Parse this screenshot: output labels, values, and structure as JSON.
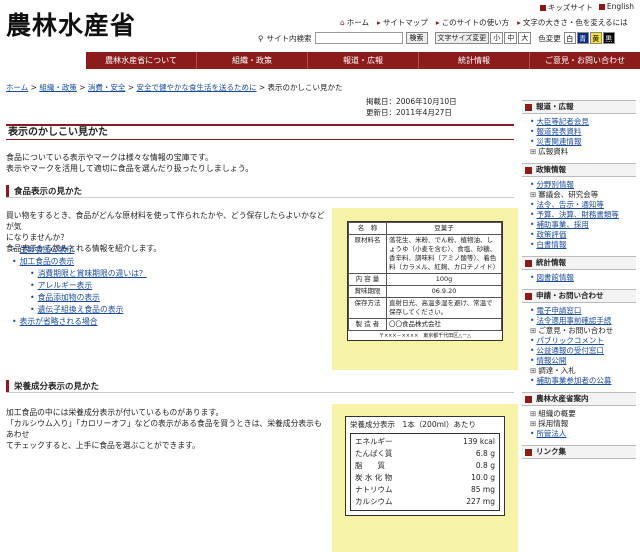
{
  "header": {
    "logo": "農林水産省",
    "util": [
      "キッズサイト",
      "English"
    ],
    "nav": [
      "ホーム",
      "サイトマップ",
      "このサイトの使い方",
      "文字の大きさ・色を変えるには"
    ],
    "search_label": "サイト内検索",
    "search_value": "",
    "search_button": "検索",
    "font_label": "文字サイズ変更",
    "font_sizes": [
      "小",
      "中",
      "大"
    ],
    "color_label": "色変更",
    "colors": [
      "白",
      "青",
      "黄",
      "黒"
    ]
  },
  "main_nav": [
    "農林水産省について",
    "組織・政策",
    "報道・広報",
    "統計情報",
    "ご意見・お問い合わせ"
  ],
  "breadcrumb": [
    "ホーム",
    "組織・政策",
    "消費・安全",
    "安全で健やかな食生活を送るために",
    "表示のかしこい見かた"
  ],
  "dates": {
    "published": "掲載日：2006年10月10日",
    "updated": "更新日：2011年4月27日"
  },
  "page_title": "表示のかしこい見かた",
  "intro": [
    "食品についている表示やマークは様々な情報の宝庫です。",
    "表示やマークを活用して適切に食品を選んだり扱ったりしましょう。"
  ],
  "section1": {
    "title": "食品表示の見かた",
    "text": [
      "買い物をするとき、食品がどんな原材料を使って作られたかや、どう保存したらよいかなどが気",
      "になりませんか？",
      "食品表示から読みとれる情報を紹介します。"
    ],
    "list": [
      {
        "label": "生鮮食品の表示",
        "level": 0
      },
      {
        "label": "加工食品の表示",
        "level": 0
      },
      {
        "label": "消費期限と賞味期限の違いは？",
        "level": 1
      },
      {
        "label": "アレルギー表示",
        "level": 1
      },
      {
        "label": "食品添加物の表示",
        "level": 1
      },
      {
        "label": "遺伝子組換え食品の表示",
        "level": 1
      },
      {
        "label": "表示が省略される場合",
        "level": 0
      }
    ]
  },
  "label1": {
    "rows": [
      {
        "k": "名　称",
        "v": "豆菓子"
      },
      {
        "k": "原材料名",
        "v": "落花生、米粉、でん粉、植物油、しょうゆ（小麦を含む）、食塩、砂糖、香辛料、調味料（アミノ酸等）、着色料（カラメル、紅麹、カロチノイド）"
      },
      {
        "k": "内 容 量",
        "v": "100g"
      },
      {
        "k": "賞味期限",
        "v": "06.9.20"
      },
      {
        "k": "保存方法",
        "v": "直射日光、高温多湿を避け、常温で保存してください。"
      },
      {
        "k": "製 造 者",
        "v": "〇〇食品株式会社"
      }
    ],
    "footer": "〒×××－××××　東京都千代田区△ー△"
  },
  "section2": {
    "title": "栄養成分表示の見かた",
    "text": [
      "加工食品の中には栄養成分表示が付いているものがあります。",
      "「カルシウム入り」「カロリーオフ」などの表示がある食品を買うときは、栄養成分表示もあわせ",
      "てチェックすると、上手に食品を選ぶことができます。"
    ]
  },
  "nutrition": {
    "header": "栄養成分表示　1本（200ml）あたり",
    "rows": [
      {
        "k": "エネルギー",
        "v": "139",
        "u": "kcal"
      },
      {
        "k": "たんぱく質",
        "v": "6.8",
        "u": "g"
      },
      {
        "k": "脂　　質",
        "v": "0.8",
        "u": "g"
      },
      {
        "k": "炭 水 化 物",
        "v": "10.0",
        "u": "g"
      },
      {
        "k": "ナトリウム",
        "v": "85",
        "u": "mg"
      },
      {
        "k": "カルシウム",
        "v": "227",
        "u": "mg"
      }
    ]
  },
  "sidebar": [
    {
      "title": "報道・広報",
      "items": [
        {
          "label": "大臣等記者会見",
          "t": "b"
        },
        {
          "label": "報道発表資料",
          "t": "b"
        },
        {
          "label": "災害関連情報",
          "t": "b"
        },
        {
          "label": "広報資料",
          "t": "p"
        }
      ]
    },
    {
      "title": "政策情報",
      "items": [
        {
          "label": "分野別情報",
          "t": "b"
        },
        {
          "label": "審議会、研究会等",
          "t": "p"
        },
        {
          "label": "法令、告示・通知等",
          "t": "b"
        },
        {
          "label": "予算、決算、財務書類等",
          "t": "b"
        },
        {
          "label": "補助事業、採用",
          "t": "b"
        },
        {
          "label": "政策評価",
          "t": "b"
        },
        {
          "label": "白書情報",
          "t": "b"
        }
      ]
    },
    {
      "title": "統計情報",
      "items": [
        {
          "label": "図書館情報",
          "t": "b"
        }
      ]
    },
    {
      "title": "申請・お問い合わせ",
      "items": [
        {
          "label": "電子申請窓口",
          "t": "b"
        },
        {
          "label": "法令適用事前確認手続",
          "t": "b"
        },
        {
          "label": "ご意見・お問い合わせ",
          "t": "p"
        },
        {
          "label": "パブリックコメント",
          "t": "b"
        },
        {
          "label": "公益通報の受付窓口",
          "t": "b"
        },
        {
          "label": "情報公開",
          "t": "b"
        },
        {
          "label": "調達・入札",
          "t": "p"
        },
        {
          "label": "補助事業参加者の公募",
          "t": "b"
        }
      ]
    },
    {
      "title": "農林水産省案内",
      "items": [
        {
          "label": "組織の概要",
          "t": "p"
        },
        {
          "label": "採用情報",
          "t": "p"
        },
        {
          "label": "所管法人",
          "t": "b"
        }
      ]
    },
    {
      "title": "リンク集",
      "items": []
    }
  ]
}
